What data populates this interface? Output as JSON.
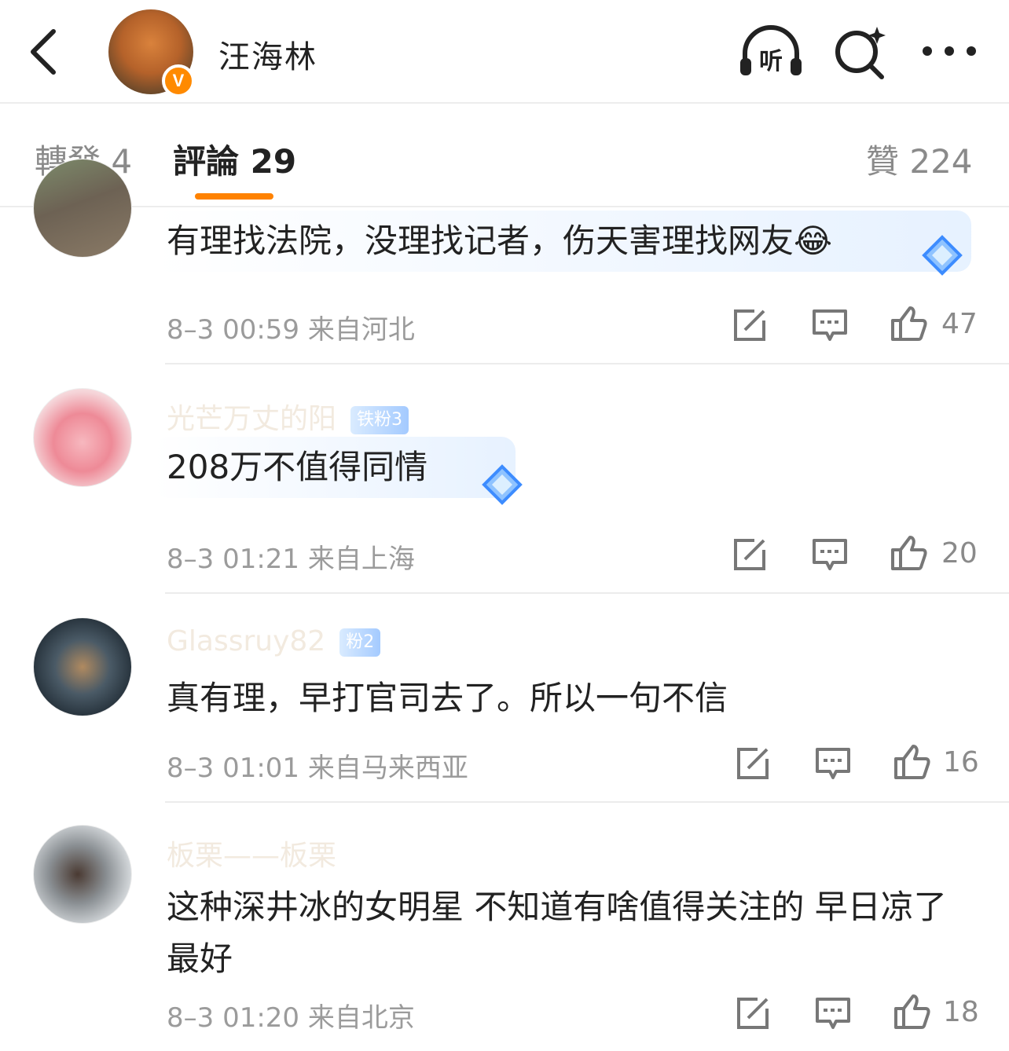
{
  "header": {
    "username": "汪海林",
    "verified_badge": "V",
    "icons": [
      "back-arrow-icon",
      "listen-icon",
      "search-sparkle-icon",
      "more-icon"
    ],
    "listen_label": "听"
  },
  "tabs": [
    {
      "label": "轉發 4",
      "active": false
    },
    {
      "label": "評論 29",
      "active": true
    },
    {
      "label": "贊 224",
      "active": false
    }
  ],
  "colors": {
    "accent": "#ff8200",
    "text": "#222222",
    "meta": "#9b9b9b",
    "divider": "#ececec"
  },
  "comments": [
    {
      "text": "有理找法院，没理找记者，伤天害理找网友😂",
      "meta": "8–3 00:59  来自河北",
      "likes": "47"
    },
    {
      "name": "光芒万丈的阳",
      "badge": "铁粉3",
      "text": "208万不值得同情",
      "meta": "8–3 01:21  来自上海",
      "likes": "20"
    },
    {
      "name": "Glassruy82",
      "badge": "粉2",
      "text": "真有理，早打官司去了。所以一句不信",
      "meta": "8–3 01:01  来自马来西亚",
      "likes": "16"
    },
    {
      "name": "板栗——板栗",
      "text": "这种深井冰的女明星 不知道有啥值得关注的 早日凉了最好",
      "meta": "8–3 01:20  来自北京",
      "likes": "18"
    }
  ]
}
